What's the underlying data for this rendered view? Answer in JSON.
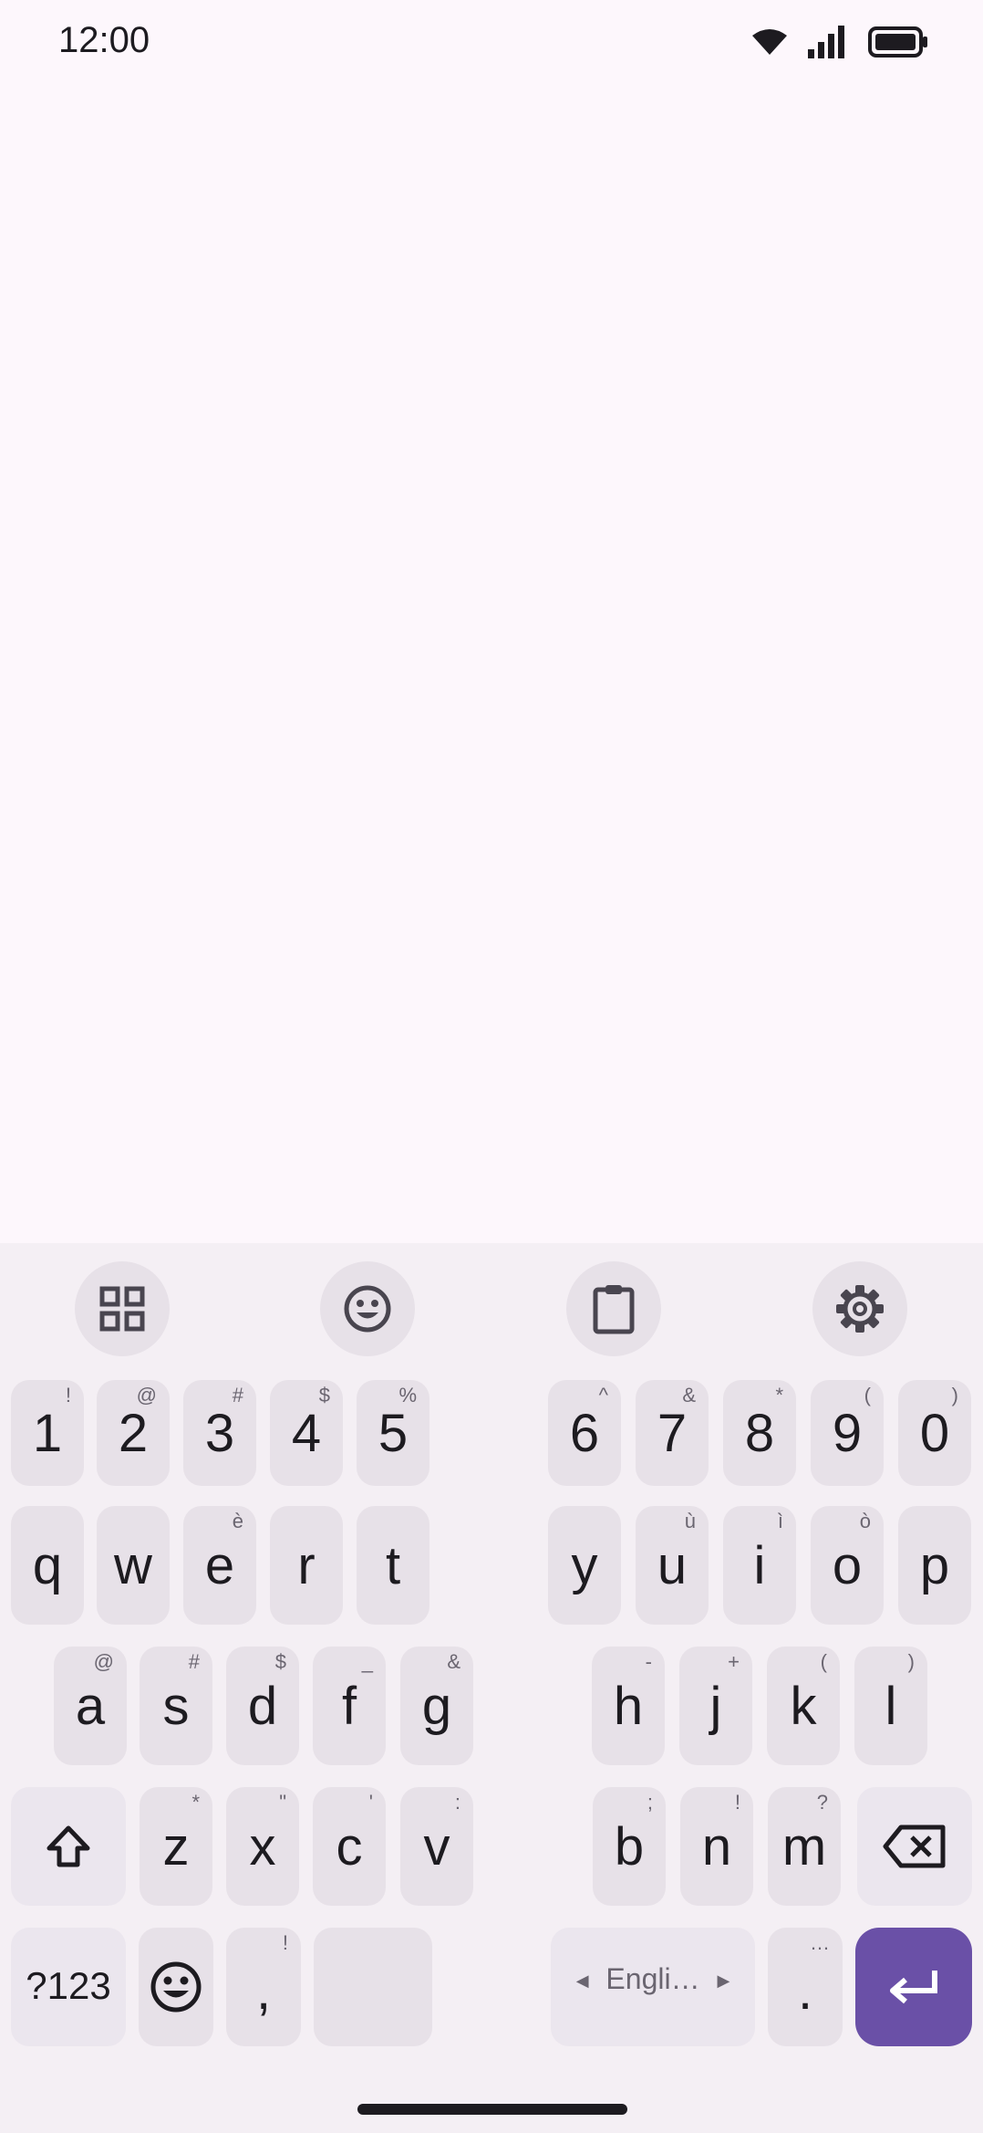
{
  "status_bar": {
    "time": "12:00"
  },
  "keyboard": {
    "toolbar": [
      "apps-grid-icon",
      "emoji-icon",
      "clipboard-icon",
      "gear-icon"
    ],
    "number_row": [
      {
        "main": "1",
        "hint": "!"
      },
      {
        "main": "2",
        "hint": "@"
      },
      {
        "main": "3",
        "hint": "#"
      },
      {
        "main": "4",
        "hint": "$"
      },
      {
        "main": "5",
        "hint": "%"
      },
      {
        "main": "6",
        "hint": "^"
      },
      {
        "main": "7",
        "hint": "&"
      },
      {
        "main": "8",
        "hint": "*"
      },
      {
        "main": "9",
        "hint": "("
      },
      {
        "main": "0",
        "hint": ")"
      }
    ],
    "row_q": [
      {
        "main": "q",
        "hint": ""
      },
      {
        "main": "w",
        "hint": ""
      },
      {
        "main": "e",
        "hint": "è"
      },
      {
        "main": "r",
        "hint": ""
      },
      {
        "main": "t",
        "hint": ""
      },
      {
        "main": "y",
        "hint": ""
      },
      {
        "main": "u",
        "hint": "ù"
      },
      {
        "main": "i",
        "hint": "ì"
      },
      {
        "main": "o",
        "hint": "ò"
      },
      {
        "main": "p",
        "hint": ""
      }
    ],
    "row_a": [
      {
        "main": "a",
        "hint": "@"
      },
      {
        "main": "s",
        "hint": "#"
      },
      {
        "main": "d",
        "hint": "$"
      },
      {
        "main": "f",
        "hint": "_"
      },
      {
        "main": "g",
        "hint": "&"
      },
      {
        "main": "h",
        "hint": "-"
      },
      {
        "main": "j",
        "hint": "+"
      },
      {
        "main": "k",
        "hint": "("
      },
      {
        "main": "l",
        "hint": ")"
      }
    ],
    "row_z": [
      {
        "main": "z",
        "hint": "*"
      },
      {
        "main": "x",
        "hint": "\""
      },
      {
        "main": "c",
        "hint": "'"
      },
      {
        "main": "v",
        "hint": ":"
      },
      {
        "main": "b",
        "hint": ";"
      },
      {
        "main": "n",
        "hint": "!"
      },
      {
        "main": "m",
        "hint": "?"
      }
    ],
    "bottom": {
      "symbols_label": "?123",
      "comma": {
        "main": ",",
        "hint": "!"
      },
      "language": "Engli…",
      "period": {
        "main": ".",
        "hint": "…"
      }
    },
    "accent_color": "#6a50a7"
  }
}
